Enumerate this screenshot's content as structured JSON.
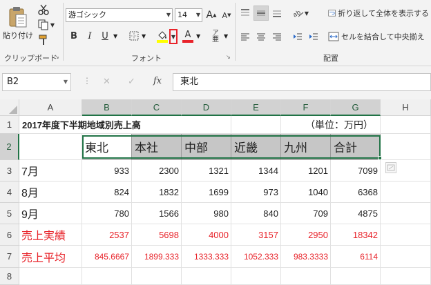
{
  "ribbon": {
    "clipboard": {
      "paste_label": "貼り付け",
      "group_label": "クリップボード"
    },
    "font": {
      "font_name": "游ゴシック",
      "font_size": "14",
      "bold": "B",
      "italic": "I",
      "underline": "U",
      "grow": "A",
      "shrink": "A",
      "font_color_glyph": "A",
      "phonetic": "ア",
      "group_label": "フォント",
      "fill_color": "#ffff00",
      "font_color": "#e8232a"
    },
    "alignment": {
      "wrap_label": "折り返して全体を表示する",
      "merge_label": "セルを結合して中央揃え",
      "group_label": "配置"
    }
  },
  "formula_bar": {
    "name_box": "B2",
    "cancel": "✕",
    "enter": "✓",
    "fx": "fx",
    "content": "東北"
  },
  "sheet": {
    "columns": [
      "A",
      "B",
      "C",
      "D",
      "E",
      "F",
      "G",
      "H"
    ],
    "rows": [
      "1",
      "2",
      "3",
      "4",
      "5",
      "6",
      "7",
      "8"
    ],
    "title": "2017年度下半期地域別売上高",
    "unit": "（単位：万円）",
    "headers": [
      "東北",
      "本社",
      "中部",
      "近畿",
      "九州",
      "合計"
    ],
    "data_rows": [
      {
        "label": "7月",
        "values": [
          "933",
          "2300",
          "1321",
          "1344",
          "1201",
          "7099"
        ]
      },
      {
        "label": "8月",
        "values": [
          "824",
          "1832",
          "1699",
          "973",
          "1040",
          "6368"
        ]
      },
      {
        "label": "9月",
        "values": [
          "780",
          "1566",
          "980",
          "840",
          "709",
          "4875"
        ]
      },
      {
        "label": "売上実績",
        "values": [
          "2537",
          "5698",
          "4000",
          "3157",
          "2950",
          "18342"
        ]
      },
      {
        "label": "売上平均",
        "values": [
          "845.6667",
          "1899.333",
          "1333.333",
          "1052.333",
          "983.3333",
          "6114"
        ]
      }
    ],
    "selected_cell": "B2"
  }
}
